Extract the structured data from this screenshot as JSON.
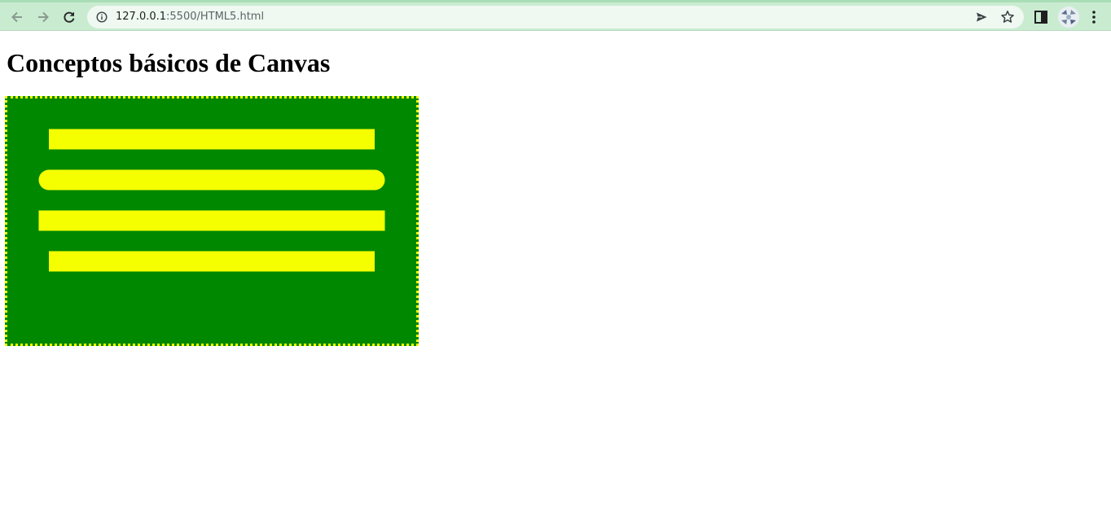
{
  "browser": {
    "url_host": "127.0.0.1",
    "url_path": ":5500/HTML5.html",
    "icons": {
      "back": "arrow-left-icon",
      "forward": "arrow-right-icon",
      "reload": "reload-icon",
      "info": "info-icon",
      "send": "send-icon",
      "bookmark": "star-icon",
      "side_panel": "side-panel-icon",
      "menu": "kebab-menu-icon"
    },
    "colors": {
      "toolbar": "#c9ecd0",
      "omnibox": "#eff8f1"
    }
  },
  "page": {
    "title": "Conceptos básicos de Canvas"
  },
  "canvas": {
    "background": "#008800",
    "border_color": "#f5ff00",
    "border_style": "dotted",
    "line_color": "#f5ff00",
    "lines": [
      {
        "cap": "butt"
      },
      {
        "cap": "round"
      },
      {
        "cap": "square"
      },
      {
        "cap": "butt"
      }
    ]
  }
}
